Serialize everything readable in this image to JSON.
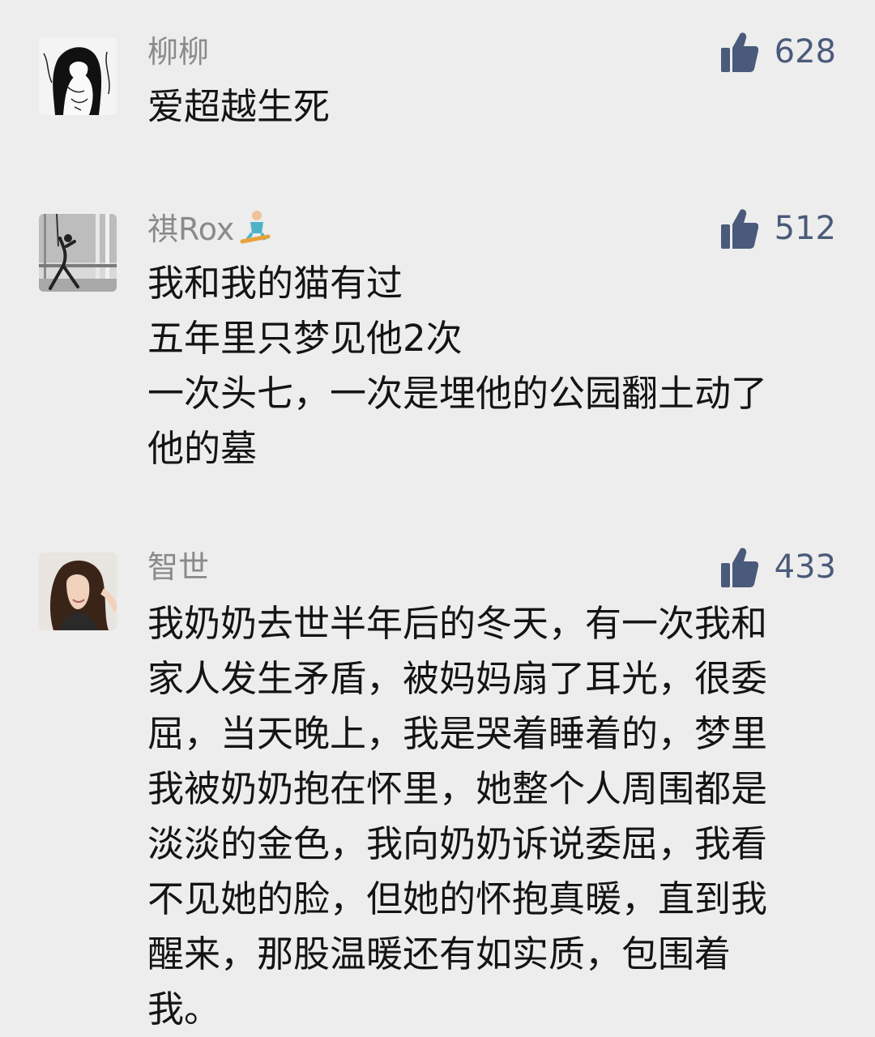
{
  "theme": {
    "background": "#ededed",
    "nickname_color": "#8a8a8a",
    "like_color": "#4a5a7a",
    "text_color": "#141414"
  },
  "comments": [
    {
      "nickname": "柳柳",
      "avatar_icon": "avatar-sketch-illustration",
      "likes": "628",
      "like_icon": "thumbs-up-icon",
      "content_lines": [
        "爱超越生死"
      ]
    },
    {
      "nickname": "祺Rox",
      "nickname_emoji": "snowboarder-emoji",
      "avatar_icon": "avatar-dancer-photo",
      "likes": "512",
      "like_icon": "thumbs-up-icon",
      "content_lines": [
        "我和我的猫有过",
        "五年里只梦见他2次",
        "一次头七，一次是埋他的公园翻土动了",
        "他的墓"
      ]
    },
    {
      "nickname": "智世",
      "avatar_icon": "avatar-woman-photo",
      "likes": "433",
      "like_icon": "thumbs-up-icon",
      "content_lines": [
        "我奶奶去世半年后的冬天，有一次我和",
        "家人发生矛盾，被妈妈扇了耳光，很委",
        "屈，当天晚上，我是哭着睡着的，梦里",
        "我被奶奶抱在怀里，她整个人周围都是",
        "淡淡的金色，我向奶奶诉说委屈，我看",
        "不见她的脸，但她的怀抱真暖，直到我",
        "醒来，那股温暖还有如实质，包围着",
        "我。"
      ]
    }
  ]
}
